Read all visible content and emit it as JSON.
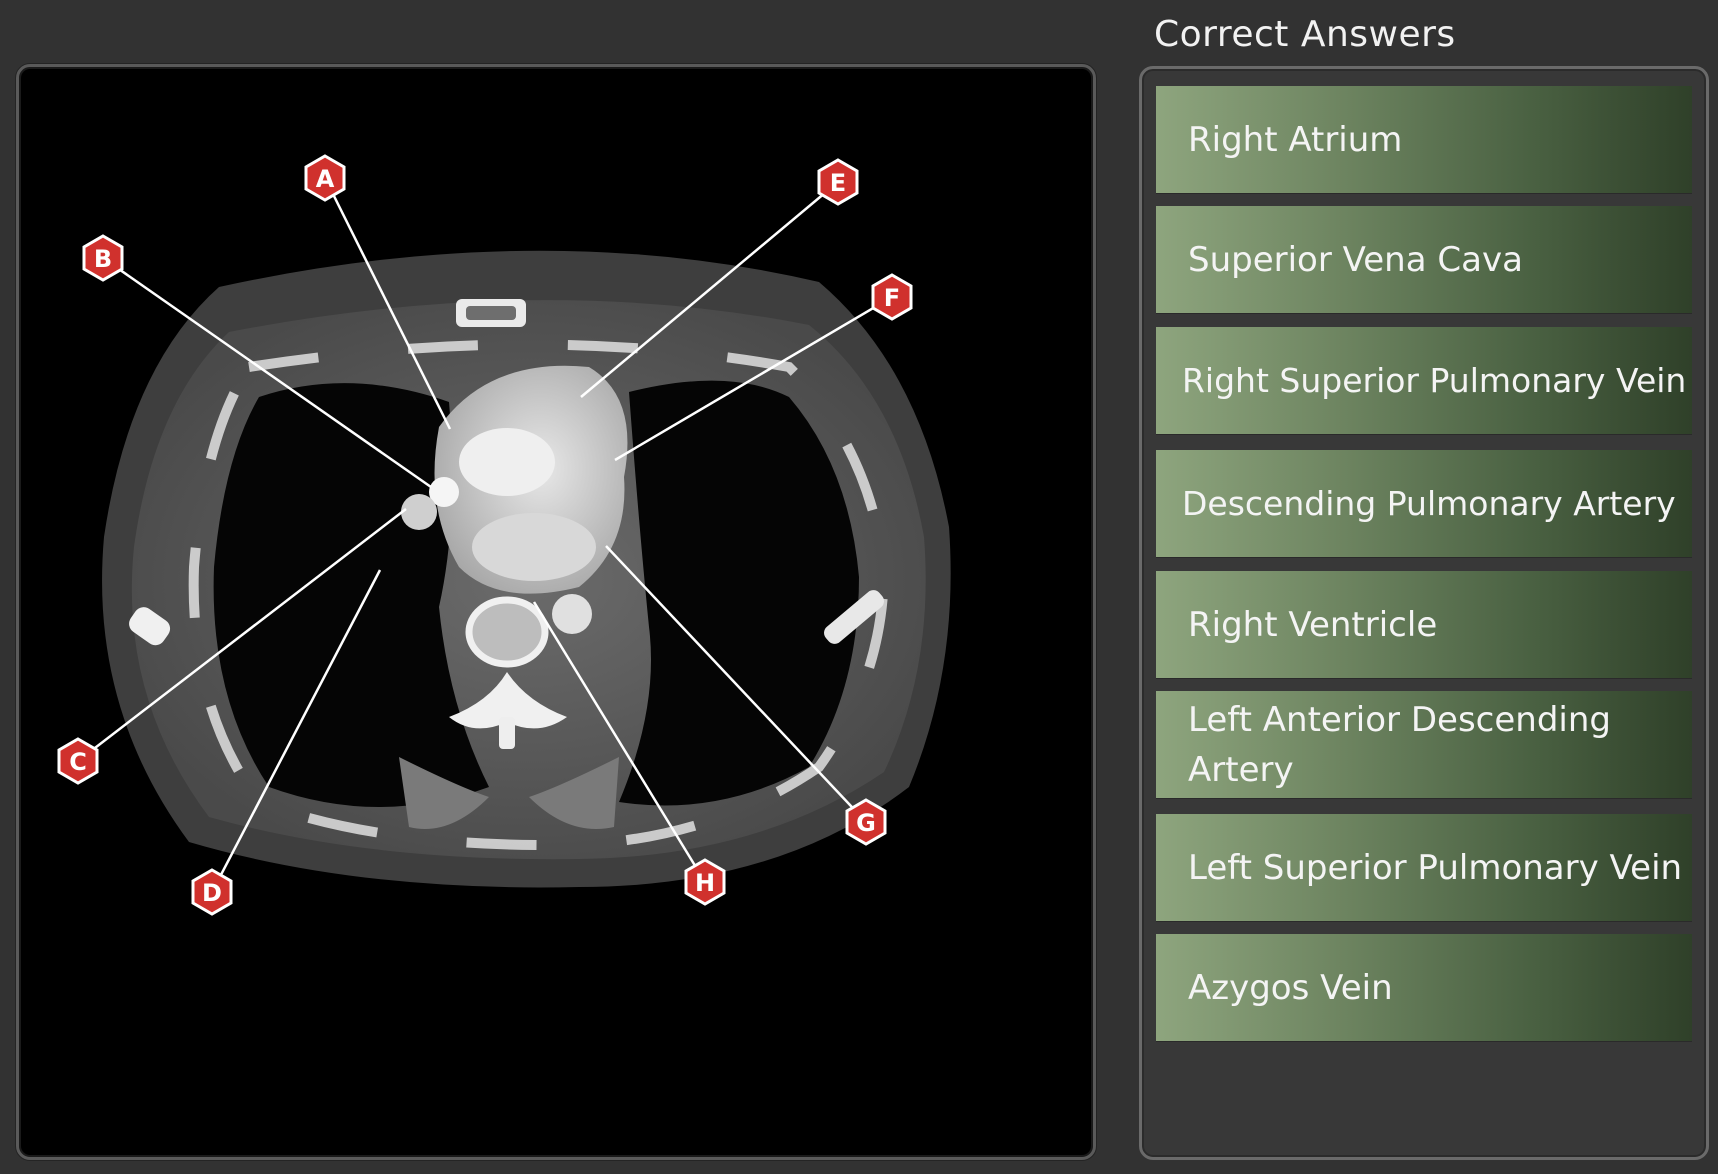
{
  "answers_title": "Correct Answers",
  "answers": [
    "Right Atrium",
    "Superior Vena Cava",
    "Right Superior Pulmonary Vein",
    "Descending Pulmonary Artery",
    "Right Ventricle",
    "Left Anterior Descending Artery",
    "Left Superior Pulmonary Vein",
    "Azygos Vein"
  ],
  "markers": [
    "A",
    "B",
    "C",
    "D",
    "E",
    "F",
    "G",
    "H"
  ],
  "colors": {
    "background": "#323232",
    "marker_fill": "#d0312d",
    "answer_gradient_start": "#8ea57e",
    "answer_gradient_end": "#2f4029"
  }
}
